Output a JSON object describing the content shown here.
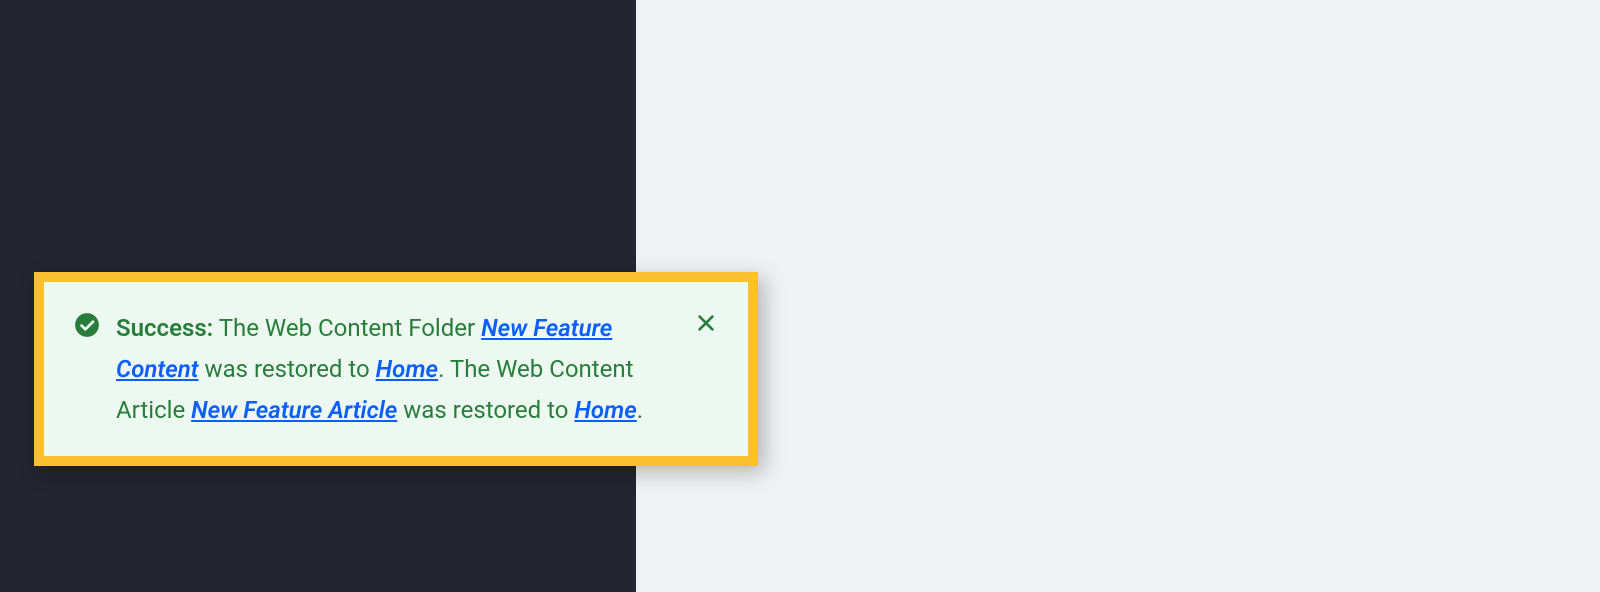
{
  "alert": {
    "label": "Success:",
    "text1": " The Web Content Folder ",
    "link1": "New Feature Content",
    "text2": " was restored to ",
    "link2": "Home",
    "text3": ". The Web Content Article ",
    "link3": "New Feature Article",
    "text4": " was restored to ",
    "link4": "Home",
    "text5": "."
  }
}
